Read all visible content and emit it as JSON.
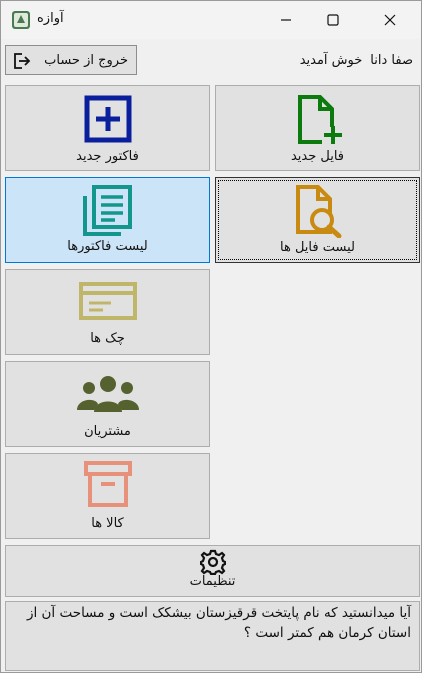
{
  "window": {
    "title": "آوازه"
  },
  "header": {
    "logout_label": "خروج از حساب",
    "user_name": "صفا دانا",
    "welcome": "خوش آمدید"
  },
  "tiles": {
    "new_invoice": {
      "label": "فاکتور جدید",
      "icon": "plus-square-icon",
      "color": "#0a1f9c"
    },
    "new_file": {
      "label": "فایل جدید",
      "icon": "file-plus-icon",
      "color": "#0d7a0d"
    },
    "invoice_list": {
      "label": "لیست فاکتورها",
      "icon": "documents-stack-icon",
      "color": "#13968c"
    },
    "file_list": {
      "label": "لیست فایل ها",
      "icon": "file-search-icon",
      "color": "#c98a12"
    },
    "checks": {
      "label": "چک ها",
      "icon": "check-card-icon",
      "color": "#bfb66a"
    },
    "customers": {
      "label": "مشتریان",
      "icon": "users-icon",
      "color": "#55622f"
    },
    "goods": {
      "label": "کالا ها",
      "icon": "archive-box-icon",
      "color": "#e8917a"
    },
    "settings": {
      "label": "تنظیمات",
      "icon": "gear-icon",
      "color": "#111111"
    }
  },
  "tip": {
    "text": "آیا میدانستید که نام پایتخت قرقیزستان بیشکک است و مساحت آن از استان کرمان هم کمتر است ؟"
  }
}
